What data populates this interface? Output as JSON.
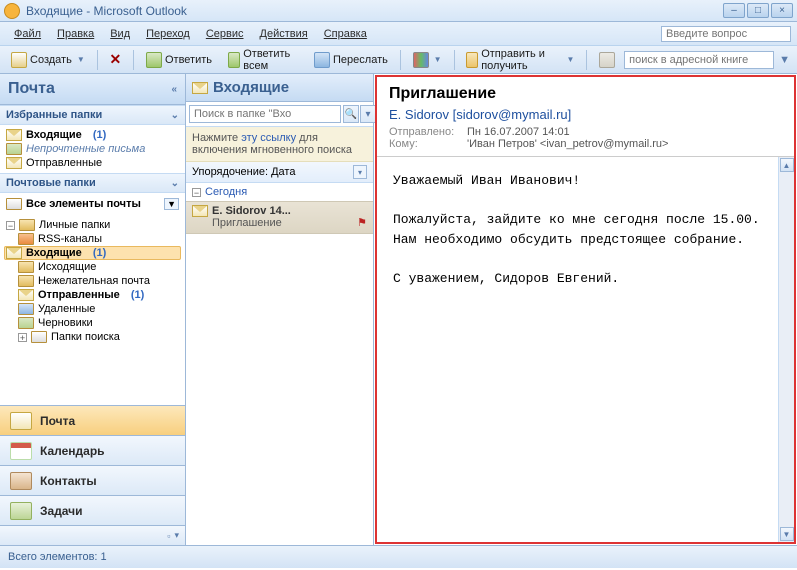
{
  "window": {
    "title": "Входящие - Microsoft Outlook"
  },
  "menu": {
    "file": "Файл",
    "edit": "Правка",
    "view": "Вид",
    "goto": "Переход",
    "tools": "Сервис",
    "actions": "Действия",
    "help": "Справка",
    "ask_placeholder": "Введите вопрос"
  },
  "toolbar": {
    "new": "Создать",
    "reply": "Ответить",
    "reply_all": "Ответить всем",
    "forward": "Переслать",
    "send_receive": "Отправить и получить",
    "addr_placeholder": "поиск в адресной книге"
  },
  "nav": {
    "header": "Почта",
    "fav_hdr": "Избранные папки",
    "fav": {
      "inbox": "Входящие",
      "inbox_count": "(1)",
      "unread": "Непрочтенные письма",
      "sent": "Отправленные"
    },
    "mail_hdr": "Почтовые папки",
    "all": "Все элементы почты",
    "tree": {
      "personal": "Личные папки",
      "rss": "RSS-каналы",
      "inbox": "Входящие",
      "inbox_count": "(1)",
      "outbox": "Исходящие",
      "junk": "Нежелательная почта",
      "sent": "Отправленные",
      "sent_count": "(1)",
      "deleted": "Удаленные",
      "drafts": "Черновики",
      "search": "Папки поиска"
    },
    "buttons": {
      "mail": "Почта",
      "calendar": "Календарь",
      "contacts": "Контакты",
      "tasks": "Задачи"
    }
  },
  "list": {
    "header": "Входящие",
    "search_placeholder": "Поиск в папке \"Вхо",
    "hint_pre": "Нажмите ",
    "hint_link": "эту ссылку",
    "hint_post": " для включения мгновенного поиска",
    "sort_label": "Упорядочение: Дата",
    "group_today": "Сегодня",
    "item": {
      "from": "E. Sidorov 14...",
      "subject": "Приглашение"
    }
  },
  "message": {
    "subject": "Приглашение",
    "from": "E. Sidorov [sidorov@mymail.ru]",
    "sent_lbl": "Отправлено:",
    "sent_val": "Пн 16.07.2007 14:01",
    "to_lbl": "Кому:",
    "to_val": "'Иван Петров' <ivan_petrov@mymail.ru>",
    "body_l1": "Уважаемый Иван Иванович!",
    "body_l2": "Пожалуйста, зайдите ко мне сегодня после 15.00.",
    "body_l3": "Нам необходимо обсудить предстоящее собрание.",
    "body_l4": "С уважением, Сидоров Евгений."
  },
  "status": {
    "text": "Всего элементов: 1"
  }
}
